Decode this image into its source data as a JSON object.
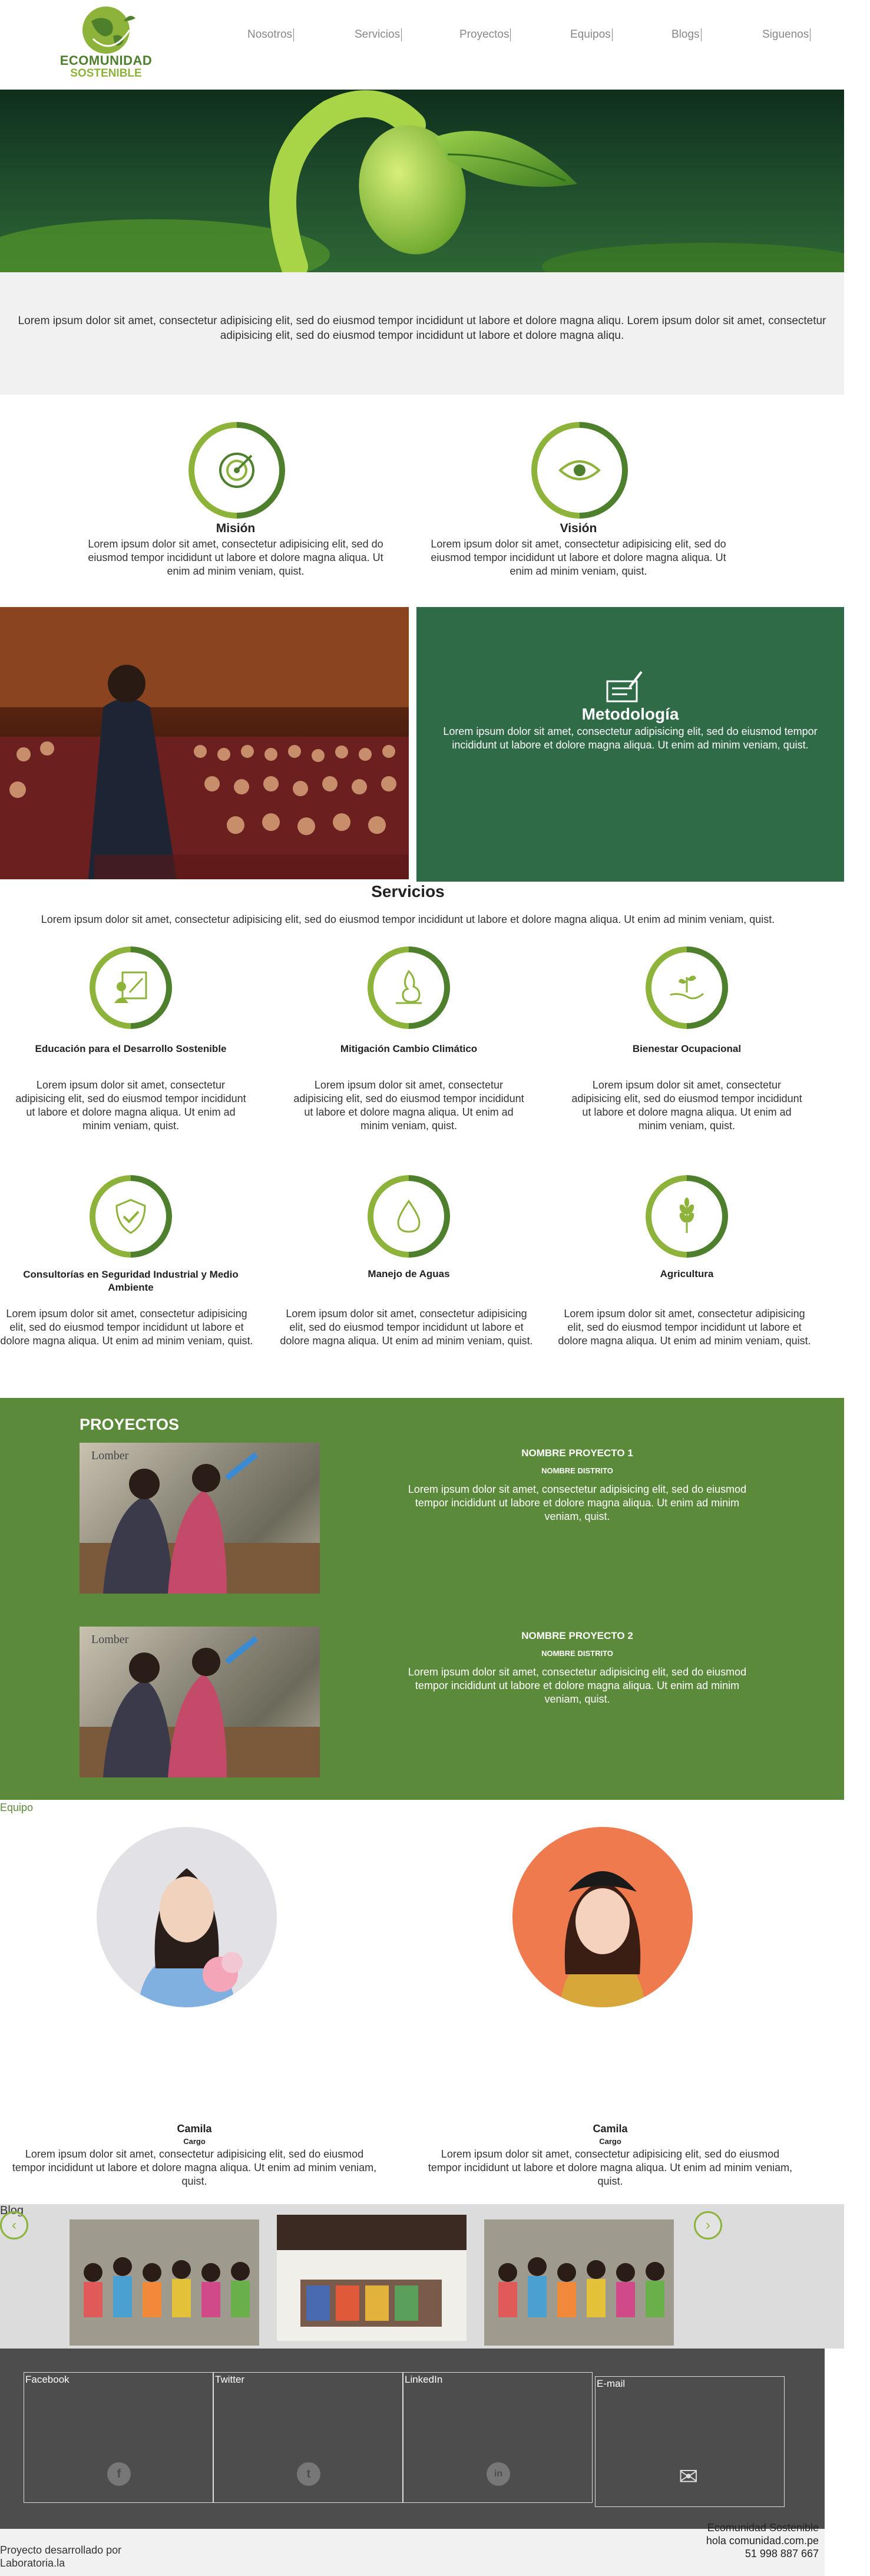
{
  "brand": {
    "line1": "ECOMUNIDAD",
    "line2": "SOSTENIBLE"
  },
  "nav": [
    "Nosotros",
    "Servicios",
    "Proyectos",
    "Equipos",
    "Blogs",
    "Siguenos"
  ],
  "intro": {
    "text": "Lorem ipsum dolor sit amet, consectetur adipisicing elit, sed do eiusmod tempor incididunt ut labore et dolore magna aliqu. Lorem ipsum dolor sit amet, consectetur adipisicing elit, sed do eiusmod tempor incididunt ut labore et dolore magna aliqu."
  },
  "mision": {
    "title": "Misión",
    "text": "Lorem ipsum dolor sit amet, consectetur adipisicing elit, sed do eiusmod tempor incididunt ut labore et dolore magna aliqua. Ut enim ad minim veniam, quist."
  },
  "vision": {
    "title": "Visión",
    "text": "Lorem ipsum dolor sit amet, consectetur adipisicing elit, sed do eiusmod tempor incididunt ut labore et dolore magna aliqua. Ut enim ad minim veniam, quist."
  },
  "metodologia": {
    "title": "Metodología",
    "text": "Lorem ipsum dolor sit amet, consectetur adipisicing elit, sed do eiusmod tempor incididunt ut labore et dolore magna aliqua. Ut enim ad minim veniam, quist."
  },
  "servicios": {
    "title": "Servicios",
    "subtitle": "Lorem ipsum dolor sit amet, consectetur adipisicing elit, sed do eiusmod tempor incididunt ut labore et dolore magna aliqua. Ut enim ad minim veniam, quist.",
    "items": [
      {
        "title": "Educación para el Desarrollo Sostenible",
        "text": "Lorem ipsum dolor sit amet, consectetur adipisicing elit, sed do eiusmod tempor incididunt ut labore et dolore magna aliqua. Ut enim ad minim veniam, quist.",
        "icon": "education-icon"
      },
      {
        "title": "Mitigación Cambio Climático",
        "text": "Lorem ipsum dolor sit amet, consectetur adipisicing elit, sed do eiusmod tempor incididunt ut labore et dolore magna aliqua. Ut enim ad minim veniam, quist.",
        "icon": "climate-icon"
      },
      {
        "title": "Bienestar Ocupacional",
        "text": "Lorem ipsum dolor sit amet, consectetur adipisicing elit, sed do eiusmod tempor incididunt ut labore et dolore magna aliqua. Ut enim ad minim veniam, quist.",
        "icon": "hand-plant-icon"
      },
      {
        "title": "Consultorías en Seguridad Industrial y Medio Ambiente",
        "text": "Lorem ipsum dolor sit amet, consectetur adipisicing elit, sed do eiusmod tempor incididunt ut labore et dolore magna aliqua. Ut enim ad minim veniam, quist.",
        "icon": "shield-check-icon"
      },
      {
        "title": "Manejo de Aguas",
        "text": "Lorem ipsum dolor sit amet, consectetur adipisicing elit, sed do eiusmod tempor incididunt ut labore et dolore magna aliqua. Ut enim ad minim veniam, quist.",
        "icon": "water-drop-icon"
      },
      {
        "title": "Agricultura",
        "text": "Lorem ipsum dolor sit amet, consectetur adipisicing elit, sed do eiusmod tempor incididunt ut labore et dolore magna aliqua. Ut enim ad minim veniam, quist.",
        "icon": "wheat-icon"
      }
    ]
  },
  "proyectos": {
    "title": "PROYECTOS",
    "items": [
      {
        "name": "NOMBRE PROYECTO 1",
        "district": "NOMBRE DISTRITO",
        "text": "Lorem ipsum dolor sit amet, consectetur adipisicing elit, sed do eiusmod tempor incididunt ut labore et dolore magna aliqua. Ut enim ad minim veniam, quist."
      },
      {
        "name": "NOMBRE PROYECTO 2",
        "district": "NOMBRE DISTRITO",
        "text": "Lorem ipsum dolor sit amet, consectetur adipisicing elit, sed do eiusmod tempor incididunt ut labore et dolore magna aliqua. Ut enim ad minim veniam, quist."
      }
    ]
  },
  "equipo": {
    "title": "Equipo",
    "members": [
      {
        "name": "Camila",
        "role": "Cargo",
        "text": "Lorem ipsum dolor sit amet, consectetur adipisicing elit, sed do eiusmod tempor incididunt ut labore et dolore magna aliqua. Ut enim ad minim veniam, quist."
      },
      {
        "name": "Camila",
        "role": "Cargo",
        "text": "Lorem ipsum dolor sit amet, consectetur adipisicing elit, sed do eiusmod tempor incididunt ut labore et dolore magna aliqua. Ut enim ad minim veniam, quist."
      }
    ]
  },
  "blog": {
    "title": "Blog"
  },
  "social": [
    {
      "label": "Facebook",
      "icon": "facebook-icon",
      "glyph": "f"
    },
    {
      "label": "Twitter",
      "icon": "twitter-icon",
      "glyph": "t"
    },
    {
      "label": "LinkedIn",
      "icon": "linkedin-icon",
      "glyph": "in"
    },
    {
      "label": "E-mail",
      "icon": "email-icon",
      "glyph": "✉"
    }
  ],
  "footer": {
    "credit_line1": "Proyecto desarrollado por",
    "credit_line2": "Laboratoria.la",
    "org": "Ecomunidad Sostenible",
    "email": "hola comunidad.com.pe",
    "phone": "51 998 887 667"
  },
  "colors": {
    "green_dark": "#4d7f2c",
    "green_light": "#8db33a",
    "projects_bg": "#5b8a3a",
    "chalk_bg": "#2f6b46",
    "footer_bg": "#4d4d4d"
  }
}
